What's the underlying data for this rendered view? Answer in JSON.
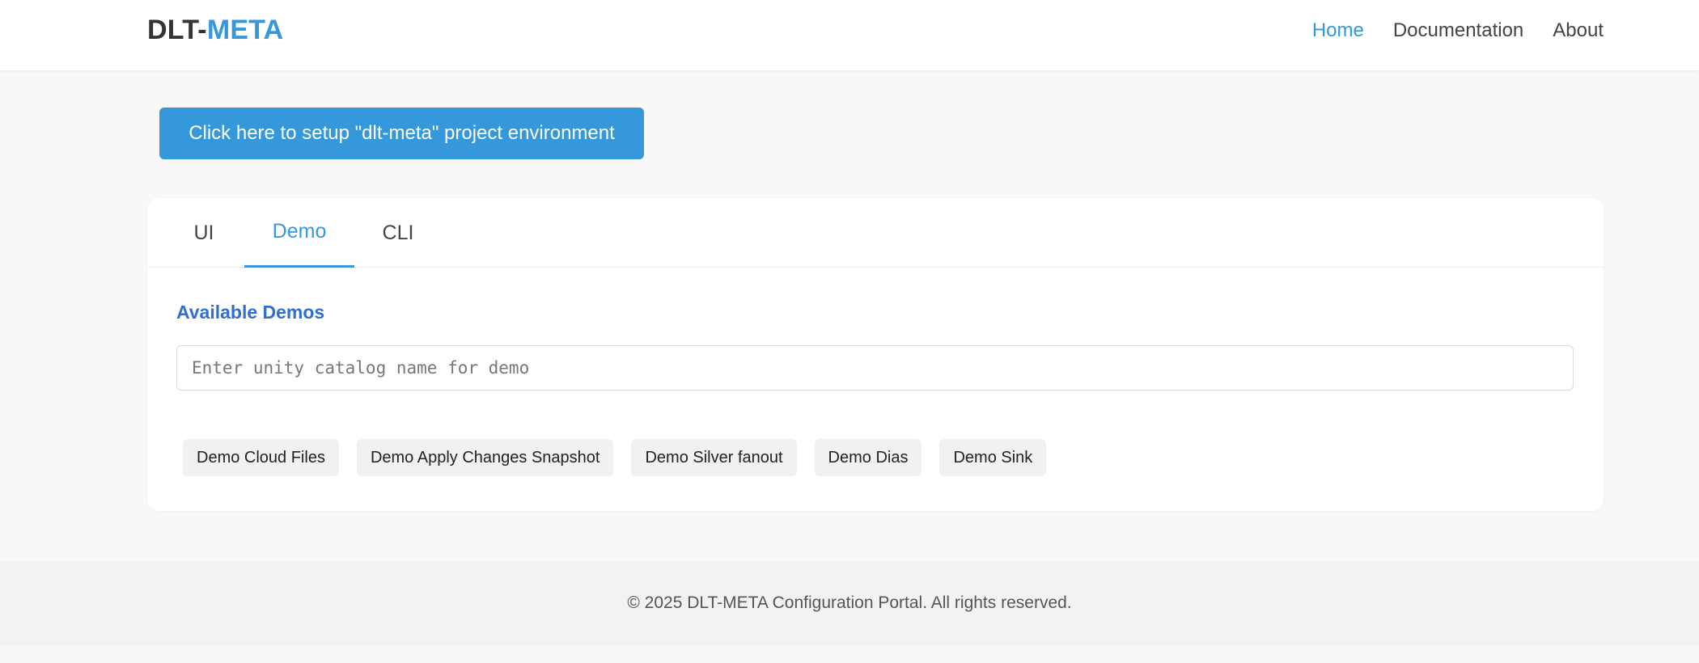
{
  "navbar": {
    "brand_prefix": "DLT-",
    "brand_accent": "META",
    "links": [
      {
        "label": "Home",
        "active": true
      },
      {
        "label": "Documentation",
        "active": false
      },
      {
        "label": "About",
        "active": false
      }
    ]
  },
  "setup_button": {
    "label": "Click here to setup \"dlt-meta\" project environment"
  },
  "tabs": [
    {
      "label": "UI",
      "active": false
    },
    {
      "label": "Demo",
      "active": true
    },
    {
      "label": "CLI",
      "active": false
    }
  ],
  "demo_panel": {
    "title": "Available Demos",
    "catalog_input": {
      "placeholder": "Enter unity catalog name for demo",
      "value": ""
    },
    "demos": [
      {
        "label": "Demo Cloud Files"
      },
      {
        "label": "Demo Apply Changes Snapshot"
      },
      {
        "label": "Demo Silver fanout"
      },
      {
        "label": "Demo Dias"
      },
      {
        "label": "Demo Sink"
      }
    ]
  },
  "footer": {
    "text": "© 2025 DLT-META Configuration Portal. All rights reserved."
  },
  "colors": {
    "accent": "#3498db",
    "section_title": "#2f6fcf",
    "page_background": "#f8f8f8"
  }
}
